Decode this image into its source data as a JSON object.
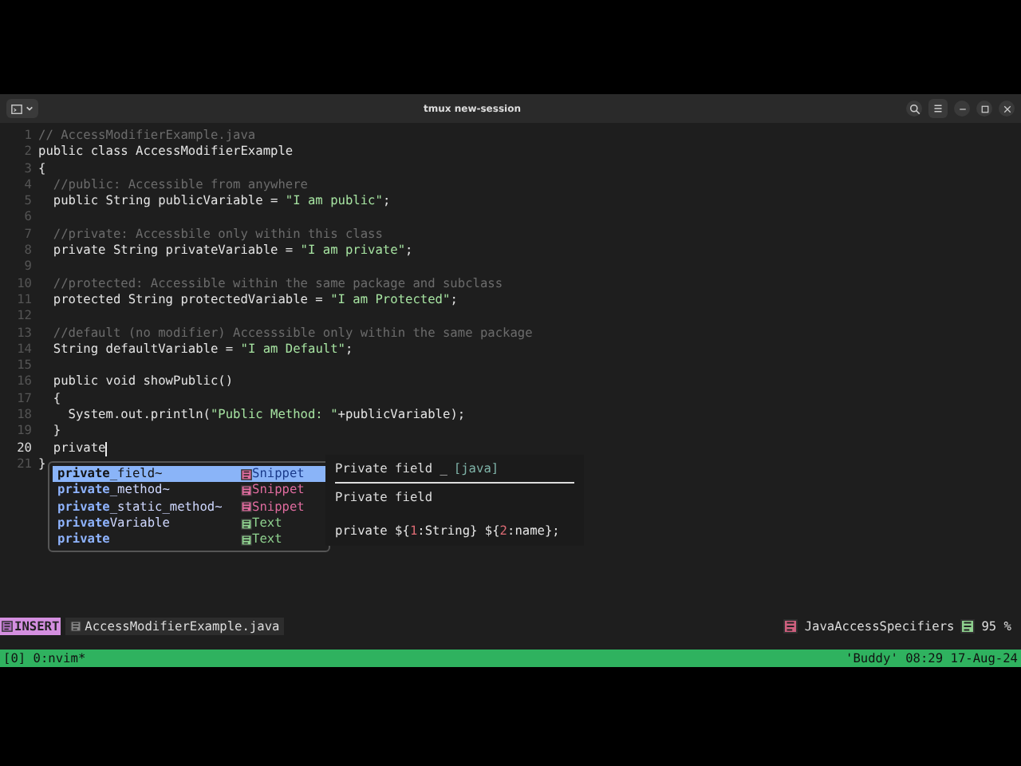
{
  "window": {
    "title": "tmux new-session"
  },
  "editor": {
    "lines": [
      {
        "number": "1",
        "current": false,
        "segments": [
          {
            "kind": "comment",
            "text": "// AccessModifierExample.java"
          }
        ]
      },
      {
        "number": "2",
        "current": false,
        "segments": [
          {
            "kind": "plain",
            "text": "public class AccessModifierExample"
          }
        ]
      },
      {
        "number": "3",
        "current": false,
        "segments": [
          {
            "kind": "plain",
            "text": "{"
          }
        ]
      },
      {
        "number": "4",
        "current": false,
        "segments": [
          {
            "kind": "comment",
            "text": "  //public: Accessible from anywhere"
          }
        ]
      },
      {
        "number": "5",
        "current": false,
        "segments": [
          {
            "kind": "plain",
            "text": "  public String publicVariable = "
          },
          {
            "kind": "string",
            "text": "\"I am public\""
          },
          {
            "kind": "plain",
            "text": ";"
          }
        ]
      },
      {
        "number": "6",
        "current": false
      },
      {
        "number": "7",
        "current": false,
        "segments": [
          {
            "kind": "comment",
            "text": "  //private: Accessbile only within this class"
          }
        ]
      },
      {
        "number": "8",
        "current": false,
        "segments": [
          {
            "kind": "plain",
            "text": "  private String privateVariable = "
          },
          {
            "kind": "string",
            "text": "\"I am private\""
          },
          {
            "kind": "plain",
            "text": ";"
          }
        ]
      },
      {
        "number": "9",
        "current": false
      },
      {
        "number": "10",
        "current": false,
        "segments": [
          {
            "kind": "comment",
            "text": "  //protected: Accessible within the same package and subclass"
          }
        ]
      },
      {
        "number": "11",
        "current": false,
        "segments": [
          {
            "kind": "plain",
            "text": "  protected String protectedVariable = "
          },
          {
            "kind": "string",
            "text": "\"I am Protected\""
          },
          {
            "kind": "plain",
            "text": ";"
          }
        ]
      },
      {
        "number": "12",
        "current": false
      },
      {
        "number": "13",
        "current": false,
        "segments": [
          {
            "kind": "comment",
            "text": "  //default (no modifier) Accesssible only within the same package"
          }
        ]
      },
      {
        "number": "14",
        "current": false,
        "segments": [
          {
            "kind": "plain",
            "text": "  String defaultVariable = "
          },
          {
            "kind": "string",
            "text": "\"I am Default\""
          },
          {
            "kind": "plain",
            "text": ";"
          }
        ]
      },
      {
        "number": "15",
        "current": false
      },
      {
        "number": "16",
        "current": false,
        "segments": [
          {
            "kind": "plain",
            "text": "  public void showPublic()"
          }
        ]
      },
      {
        "number": "17",
        "current": false,
        "segments": [
          {
            "kind": "plain",
            "text": "  {"
          }
        ]
      },
      {
        "number": "18",
        "current": false,
        "segments": [
          {
            "kind": "plain",
            "text": "    System.out.println("
          },
          {
            "kind": "string",
            "text": "\"Public Method: \""
          },
          {
            "kind": "plain",
            "text": "+publicVariable);"
          }
        ]
      },
      {
        "number": "19",
        "current": false,
        "segments": [
          {
            "kind": "plain",
            "text": "  }"
          }
        ]
      },
      {
        "number": "20",
        "current": true,
        "segments": [
          {
            "kind": "plain",
            "text": "  private"
          }
        ]
      },
      {
        "number": "21",
        "current": false,
        "segments": [
          {
            "kind": "plain",
            "text": "}"
          }
        ]
      }
    ]
  },
  "completion": {
    "items": [
      {
        "label": "**private**_field~",
        "kind": "snippet",
        "type_label": "Snippet",
        "selected": true
      },
      {
        "label": "**private**_method~",
        "kind": "snippet",
        "type_label": "Snippet",
        "selected": false
      },
      {
        "label": "**private**_static_method~",
        "kind": "snippet",
        "type_label": "Snippet",
        "selected": false
      },
      {
        "label": "**private**Variable",
        "kind": "text",
        "type_label": "Text",
        "selected": false
      },
      {
        "label": "**private**",
        "kind": "text",
        "type_label": "Text",
        "selected": false
      }
    ]
  },
  "documentation": {
    "title": "Private field _",
    "filetype": "[java]",
    "description": "Private field",
    "snippet": [
      {
        "kind": "plain",
        "text": "private ${"
      },
      {
        "kind": "placeholder",
        "text": "1"
      },
      {
        "kind": "plain",
        "text": ":String} ${"
      },
      {
        "kind": "placeholder",
        "text": "2"
      },
      {
        "kind": "plain",
        "text": ":name};"
      }
    ]
  },
  "statusline": {
    "mode": "INSERT",
    "file": "AccessModifierExample.java",
    "tag": "JavaAccessSpecifiers",
    "progress": "95 %"
  },
  "tmux": {
    "left": "[0] 0:nvim*",
    "right": "'Buddy' 08:29 17-Aug-24"
  }
}
